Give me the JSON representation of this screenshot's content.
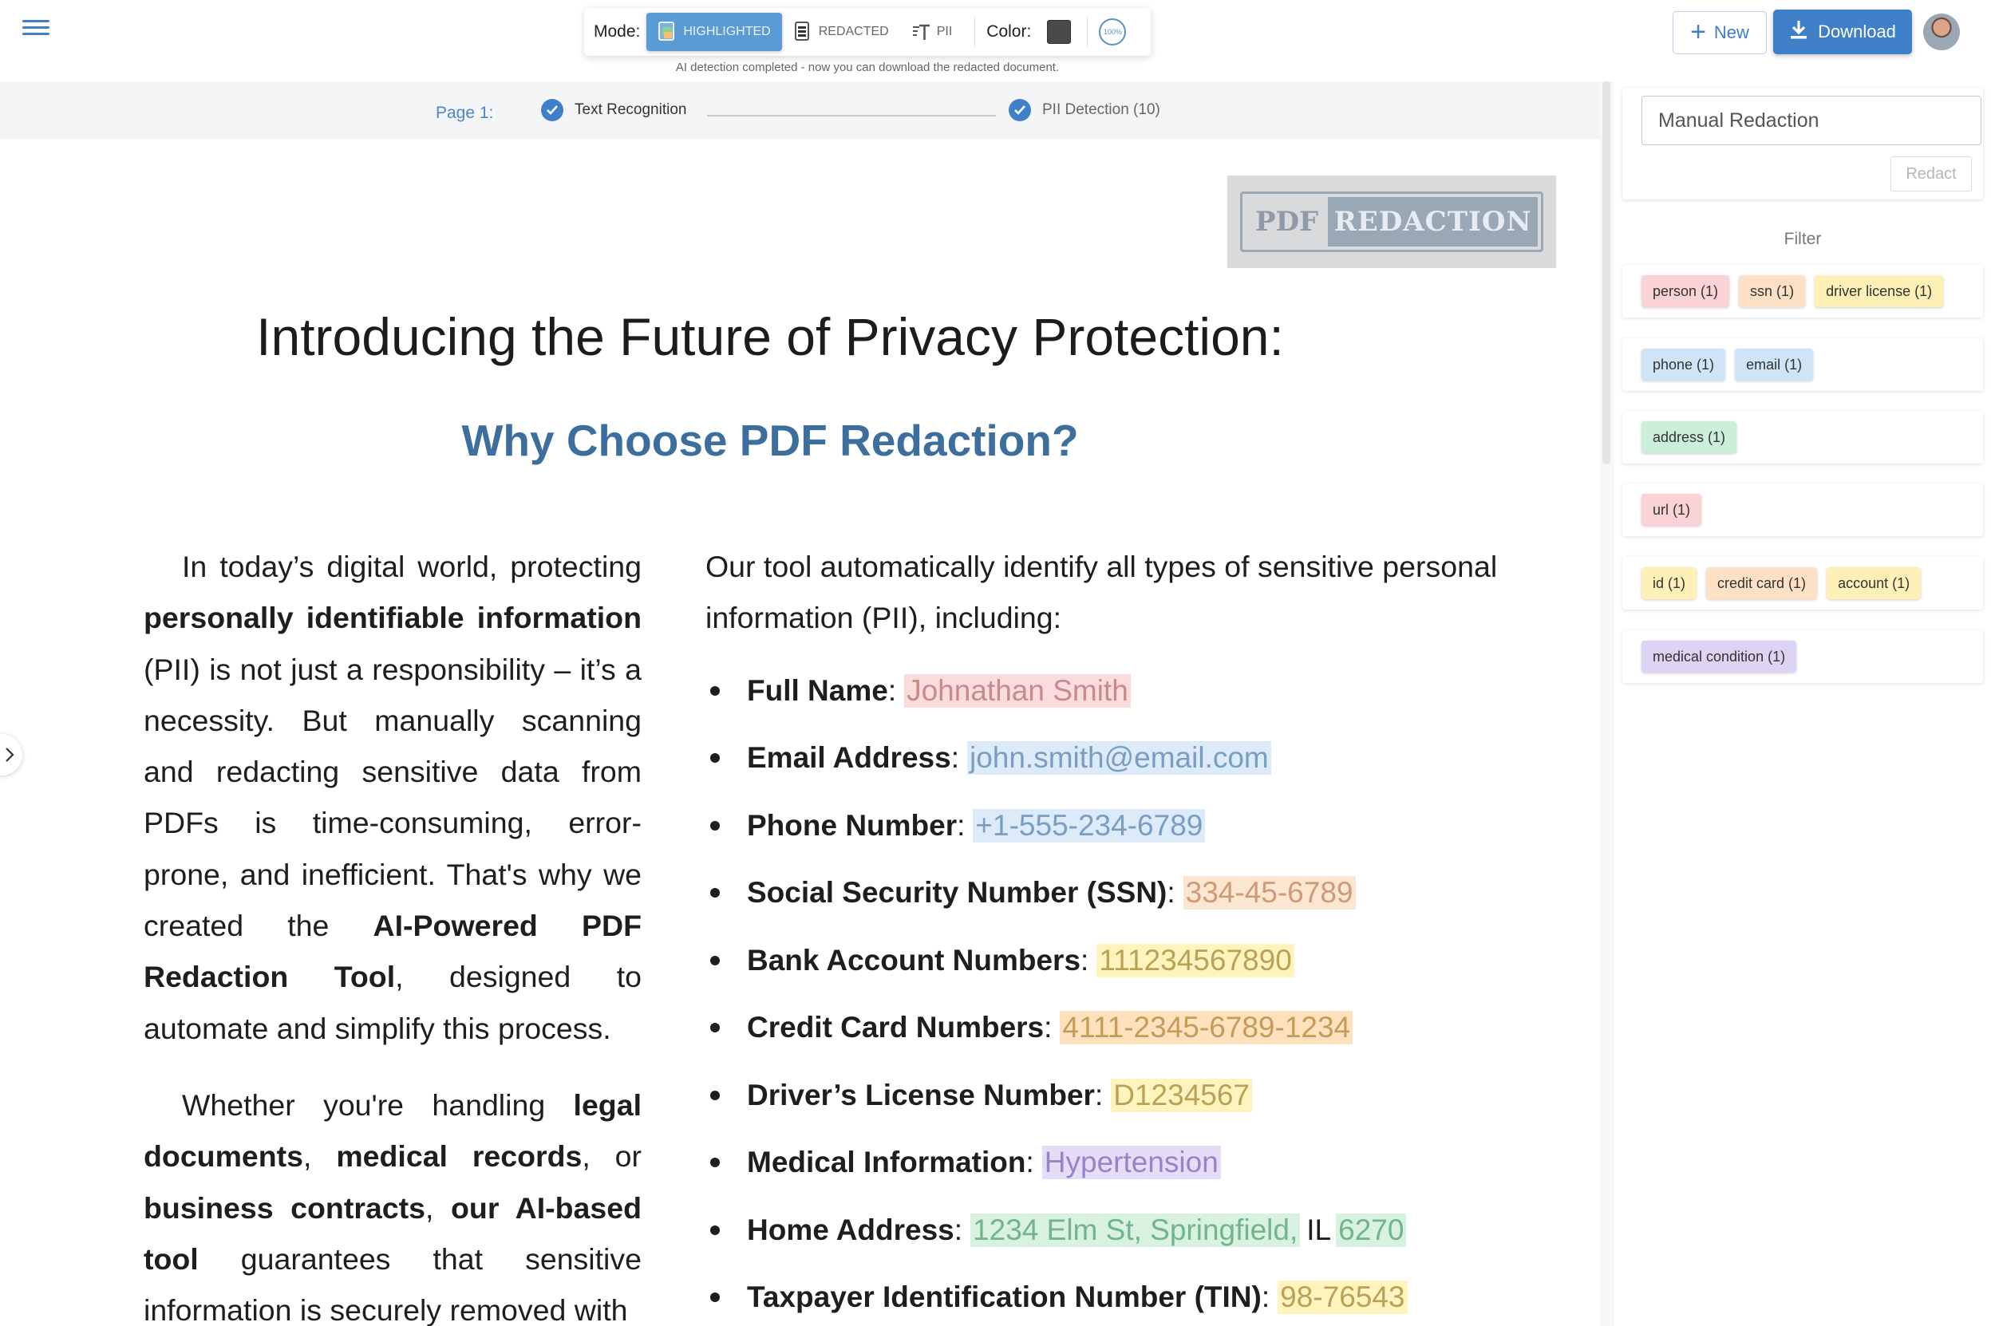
{
  "toolbar": {
    "mode_label": "Mode:",
    "modes": [
      {
        "label": "HIGHLIGHTED",
        "icon": "highlighted-icon",
        "active": true
      },
      {
        "label": "REDACTED",
        "icon": "redacted-icon",
        "active": false
      },
      {
        "label": "PII",
        "icon": "pii-text-icon",
        "active": false
      }
    ],
    "color_label": "Color:",
    "color_value": "#4a4a4a",
    "zoom": "100%",
    "status": "AI detection completed - now you can download the redacted document."
  },
  "header": {
    "new_label": "New",
    "download_label": "Download",
    "accent": "#3f80c8"
  },
  "progress": {
    "page_label": "Page 1:",
    "steps": [
      {
        "label": "Text Recognition"
      },
      {
        "label": "PII Detection (10)"
      }
    ]
  },
  "document": {
    "logo_left": "PDF",
    "logo_right": "REDACTION",
    "title": "Introducing the Future of Privacy Protection:",
    "subtitle": "Why Choose  PDF Redaction?",
    "left_col": {
      "p1": [
        "In today’s digital world, protecting ",
        "personally identifiable information",
        " (PII) is not just a responsibility – it’s a necessity. But manually scanning and redacting sensitive data from PDFs is time-consuming, error-prone, and inefficient. That's why we created the ",
        "AI-Powered PDF Redaction Tool",
        ", designed to automate and simplify this process."
      ],
      "p2": [
        "Whether you're handling ",
        "legal documents",
        ", ",
        "medical records",
        ", or ",
        "business contracts",
        ", ",
        "our AI-based tool",
        " guarantees that sensitive information is securely removed with"
      ]
    },
    "intro": "Our tool automatically identify all types of sensitive personal information (PII), including:",
    "pii_items": [
      {
        "label": "Full Name",
        "value": "Johnathan Smith"
      },
      {
        "label": "Email Address",
        "value": "john.smith@email.com"
      },
      {
        "label": "Phone Number",
        "value": "+1-555-234-6789"
      },
      {
        "label": "Social Security Number (SSN)",
        "value": "334-45-6789"
      },
      {
        "label": "Bank Account Numbers",
        "value": "111234567890"
      },
      {
        "label": "Credit Card Numbers",
        "value": "4111-2345-6789-1234"
      },
      {
        "label": "Driver’s License Number",
        "value": "D1234567"
      },
      {
        "label": "Medical Information",
        "value": "Hypertension"
      },
      {
        "label": "Home Address",
        "value_a": "1234 Elm St, Springfield,",
        "value_b": "IL",
        "value_c": "6270"
      },
      {
        "label": "Taxpayer Identification Number (TIN)",
        "value": "98-76543"
      }
    ]
  },
  "panel": {
    "manual_placeholder": "Manual Redaction",
    "redact_label": "Redact",
    "filter_title": "Filter",
    "groups": [
      [
        {
          "label": "person (1)",
          "color": "#fbd3d6"
        },
        {
          "label": "ssn (1)",
          "color": "#fde0c5"
        },
        {
          "label": "driver license (1)",
          "color": "#fff0b8"
        }
      ],
      [
        {
          "label": "phone (1)",
          "color": "#cfe4f7"
        },
        {
          "label": "email (1)",
          "color": "#cfe4f7"
        }
      ],
      [
        {
          "label": "address (1)",
          "color": "#cdeedb"
        }
      ],
      [
        {
          "label": "url (1)",
          "color": "#fbd3d6"
        }
      ],
      [
        {
          "label": "id (1)",
          "color": "#fff0b8"
        },
        {
          "label": "credit card (1)",
          "color": "#fde0c5"
        },
        {
          "label": "account (1)",
          "color": "#fff0b8"
        }
      ],
      [
        {
          "label": "medical condition (1)",
          "color": "#ddd3f2"
        }
      ]
    ]
  }
}
